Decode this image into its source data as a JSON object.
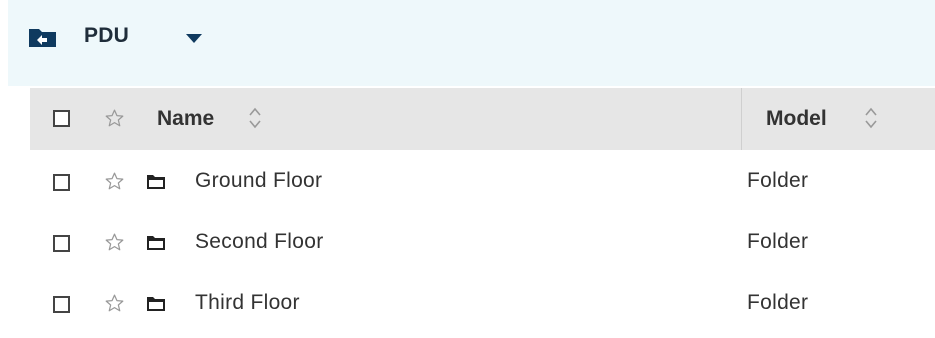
{
  "header": {
    "title": "PDU"
  },
  "table": {
    "columns": [
      {
        "label": "Name"
      },
      {
        "label": "Model"
      }
    ],
    "rows": [
      {
        "name": "Ground Floor",
        "model": "Folder"
      },
      {
        "name": "Second Floor",
        "model": "Folder"
      },
      {
        "name": "Third Floor",
        "model": "Folder"
      }
    ]
  },
  "colors": {
    "header_bg": "#eef8fb",
    "accent": "#0f3a5f",
    "table_head_bg": "#e6e6e6"
  },
  "icons": [
    "folder-back-icon",
    "caret-down-icon",
    "checkbox",
    "star-icon",
    "sort-icon",
    "folder-icon"
  ]
}
